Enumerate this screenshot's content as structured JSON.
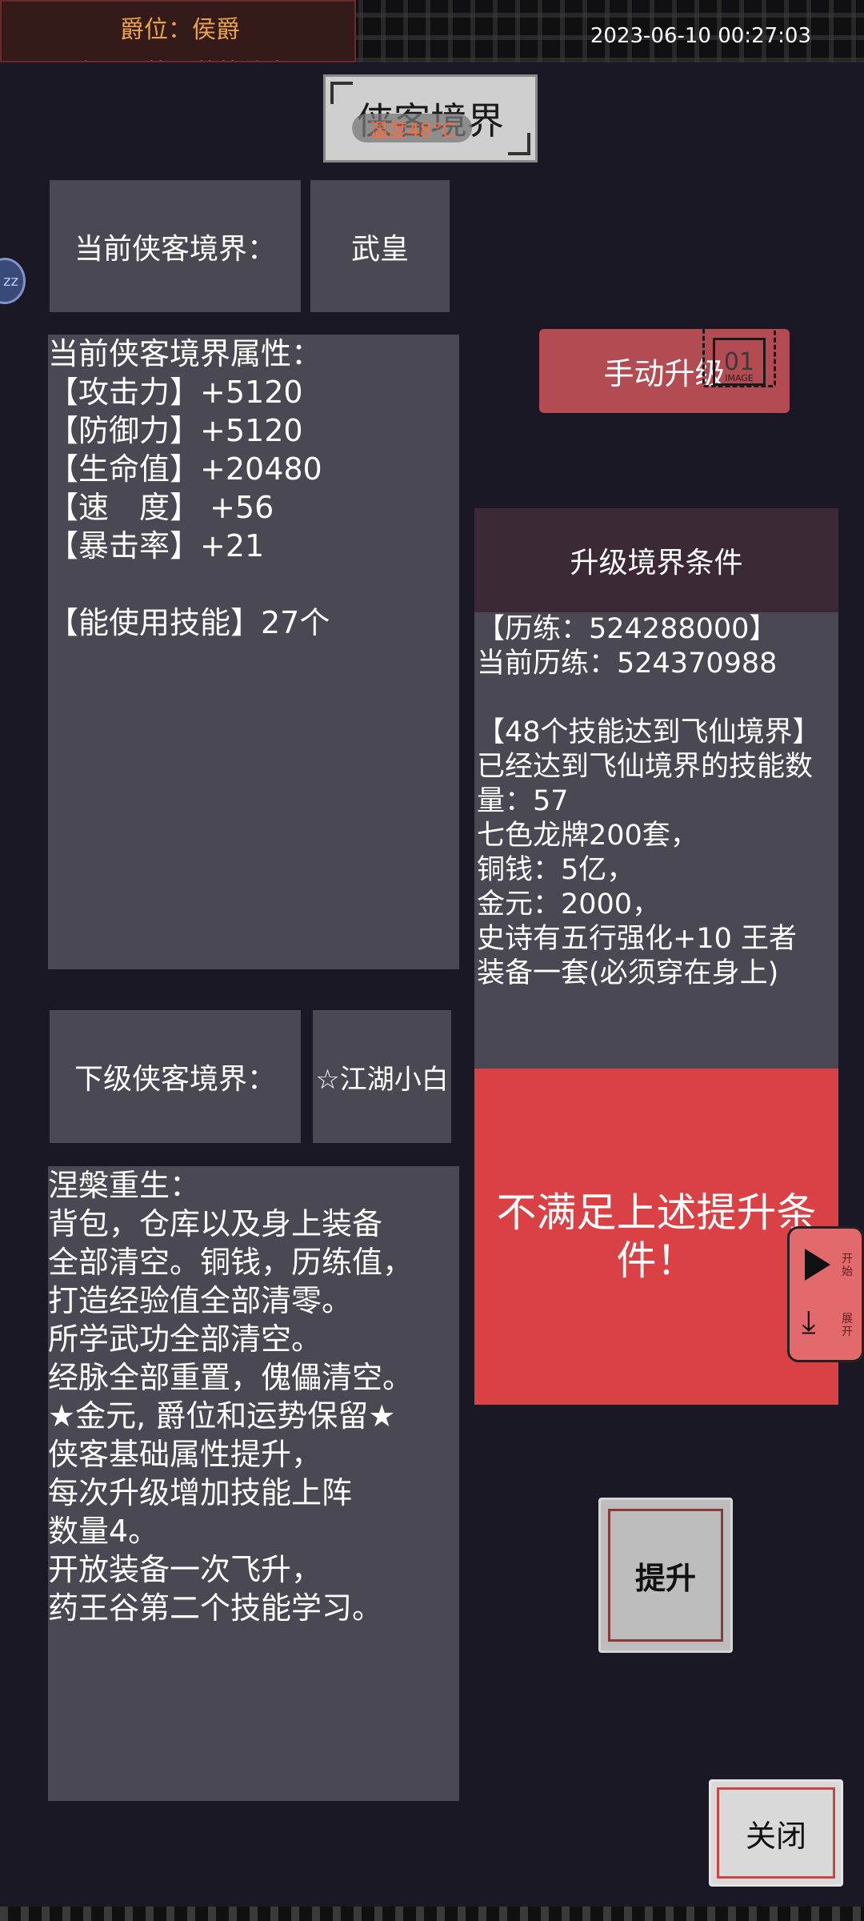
{
  "status_bar": {
    "rank": "爵位：侯爵",
    "fortune": "今日运势：蓄势待发",
    "datetime": "2023-06-10 00:27:03"
  },
  "header": {
    "title": "侠客境界",
    "temperature": "温度48°C"
  },
  "sleep_badge": "zz",
  "current_realm": {
    "label": "当前侠客境界：",
    "value": "武皇"
  },
  "attributes": {
    "text": "当前侠客境界属性：\n【攻击力】+5120\n【防御力】+5120\n【生命值】+20480\n【速　度】 +56\n【暴击率】+21\n\n【能使用技能】27个"
  },
  "next_realm": {
    "label": "下级侠客境界：",
    "value": "☆江湖小白"
  },
  "nirvana": {
    "text": "涅槃重生：\n背包，仓库以及身上装备\n全部清空。铜钱，历练值，\n打造经验值全部清零。\n所学武功全部清空。\n经脉全部重置，傀儡清空。\n★金元, 爵位和运势保留★\n侠客基础属性提升，\n每次升级增加技能上阵\n数量4。\n开放装备一次飞升，\n药王谷第二个技能学习。"
  },
  "manual_upgrade": {
    "label": "手动升级",
    "icon_text": "01",
    "icon_caption": "IMAGE"
  },
  "conditions": {
    "header": "升级境界条件",
    "text": "【历练：524288000】\n当前历练：524370988\n\n【48个技能达到飞仙境界】\n已经达到飞仙境界的技能数\n量：57\n七色龙牌200套，\n铜钱：5亿，\n金元：2000，\n史诗有五行强化+10 王者\n装备一套(必须穿在身上)"
  },
  "warning": {
    "line1": "不满足上述提升条",
    "line2": "件！"
  },
  "side_panel": {
    "open_label": "开始",
    "expand_label": "展开"
  },
  "buttons": {
    "promote": "提升",
    "close": "关闭"
  },
  "colors": {
    "background": "#1b1826",
    "panel": "#4a4852",
    "accent_red": "#d94144",
    "upgrade_button": "#b34c52",
    "rank_text": "#e8a24a"
  }
}
